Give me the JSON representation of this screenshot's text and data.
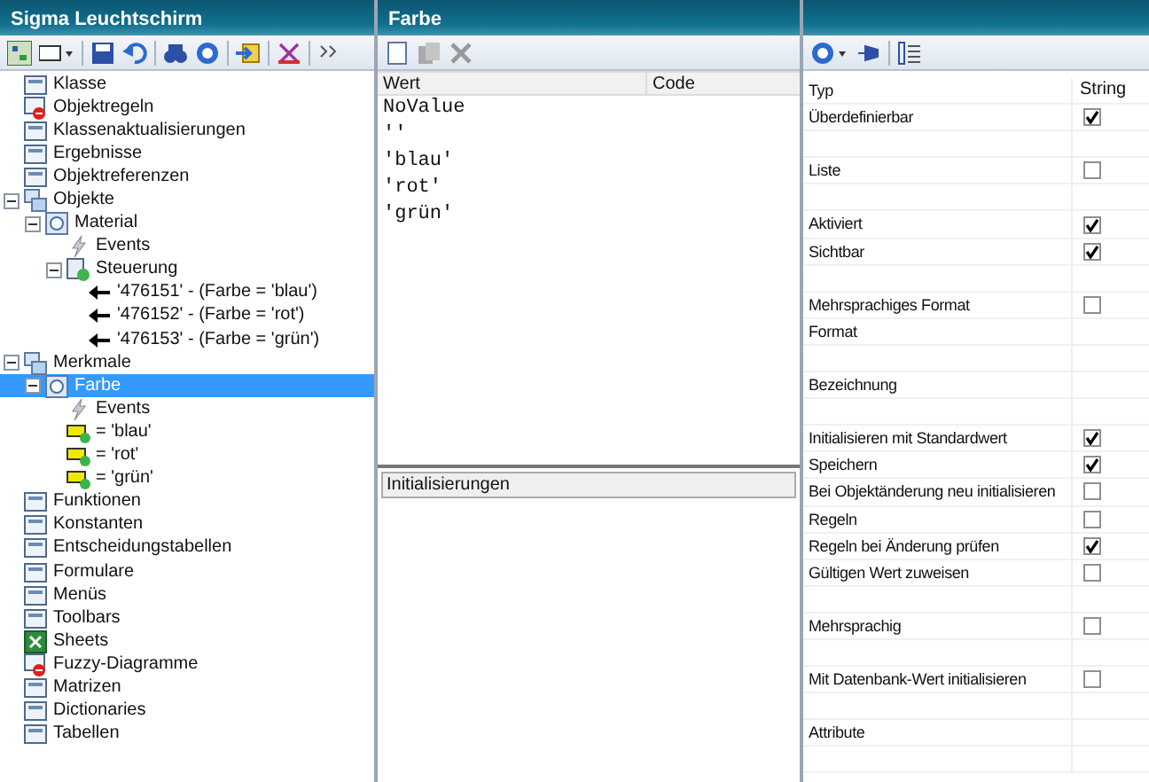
{
  "left_panel": {
    "title": "Sigma Leuchtschirm",
    "tree": [
      {
        "label": "Klasse",
        "kind": "node"
      },
      {
        "label": "Objektregeln",
        "kind": "rule"
      },
      {
        "label": "Klassenaktualisierungen",
        "kind": "node"
      },
      {
        "label": "Ergebnisse",
        "kind": "node"
      },
      {
        "label": "Objektreferenzen",
        "kind": "node"
      },
      {
        "label": "Objekte",
        "kind": "group",
        "expanded": true,
        "children": [
          {
            "label": "Material",
            "kind": "object",
            "expanded": true,
            "children": [
              {
                "label": "Events",
                "kind": "event"
              },
              {
                "label": "Steuerung",
                "kind": "control",
                "expanded": true,
                "children": [
                  {
                    "label": "'476151' - (Farbe = 'blau')",
                    "kind": "reference"
                  },
                  {
                    "label": "'476152' - (Farbe = 'rot')",
                    "kind": "reference"
                  },
                  {
                    "label": "'476153' - (Farbe = 'grün')",
                    "kind": "reference"
                  }
                ]
              }
            ]
          }
        ]
      },
      {
        "label": "Merkmale",
        "kind": "group",
        "expanded": true,
        "children": [
          {
            "label": "Farbe",
            "kind": "object",
            "expanded": true,
            "selected": true,
            "children": [
              {
                "label": "Events",
                "kind": "event"
              },
              {
                "label": "= 'blau'",
                "kind": "value"
              },
              {
                "label": "= 'rot'",
                "kind": "value"
              },
              {
                "label": "= 'grün'",
                "kind": "value"
              }
            ]
          }
        ]
      },
      {
        "label": "Funktionen",
        "kind": "node"
      },
      {
        "label": "Konstanten",
        "kind": "node"
      },
      {
        "label": "Entscheidungstabellen",
        "kind": "node"
      },
      {
        "label": "Formulare",
        "kind": "node"
      },
      {
        "label": "Menüs",
        "kind": "node"
      },
      {
        "label": "Toolbars",
        "kind": "node"
      },
      {
        "label": "Sheets",
        "kind": "sheet"
      },
      {
        "label": "Fuzzy-Diagramme",
        "kind": "rule"
      },
      {
        "label": "Matrizen",
        "kind": "node"
      },
      {
        "label": "Dictionaries",
        "kind": "node"
      },
      {
        "label": "Tabellen",
        "kind": "node"
      }
    ]
  },
  "middle_panel": {
    "title": "Farbe",
    "columns": [
      "Wert",
      "Code"
    ],
    "rows": [
      {
        "wert": "NoValue"
      },
      {
        "wert": "''"
      },
      {
        "wert": "'blau'"
      },
      {
        "wert": "'rot'"
      },
      {
        "wert": "'grün'"
      }
    ],
    "section_title": "Initialisierungen"
  },
  "properties": [
    {
      "kind": "text",
      "label": "Typ",
      "value": "String"
    },
    {
      "kind": "checkbox",
      "label": "Überdefinierbar",
      "checked": true
    },
    {
      "kind": "spacer"
    },
    {
      "kind": "checkbox",
      "label": "Liste",
      "checked": false
    },
    {
      "kind": "spacer"
    },
    {
      "kind": "checkbox",
      "label": "Aktiviert",
      "checked": true
    },
    {
      "kind": "checkbox",
      "label": "Sichtbar",
      "checked": true
    },
    {
      "kind": "spacer"
    },
    {
      "kind": "checkbox",
      "label": "Mehrsprachiges Format",
      "checked": false
    },
    {
      "kind": "text",
      "label": "Format"
    },
    {
      "kind": "spacer"
    },
    {
      "kind": "text",
      "label": "Bezeichnung"
    },
    {
      "kind": "spacer"
    },
    {
      "kind": "checkbox",
      "label": "Initialisieren mit Standardwert",
      "checked": true
    },
    {
      "kind": "checkbox",
      "label": "Speichern",
      "checked": true
    },
    {
      "kind": "checkbox",
      "label": "Bei Objektänderung neu initialisieren",
      "checked": false
    },
    {
      "kind": "checkbox",
      "label": "Regeln",
      "checked": false
    },
    {
      "kind": "checkbox",
      "label": "Regeln bei Änderung prüfen",
      "checked": true
    },
    {
      "kind": "checkbox",
      "label": "Gültigen Wert zuweisen",
      "checked": false
    },
    {
      "kind": "spacer"
    },
    {
      "kind": "checkbox",
      "label": "Mehrsprachig",
      "checked": false
    },
    {
      "kind": "spacer"
    },
    {
      "kind": "checkbox",
      "label": "Mit Datenbank-Wert initialisieren",
      "checked": false
    },
    {
      "kind": "spacer"
    },
    {
      "kind": "text",
      "label": "Attribute"
    },
    {
      "kind": "spacer"
    }
  ]
}
